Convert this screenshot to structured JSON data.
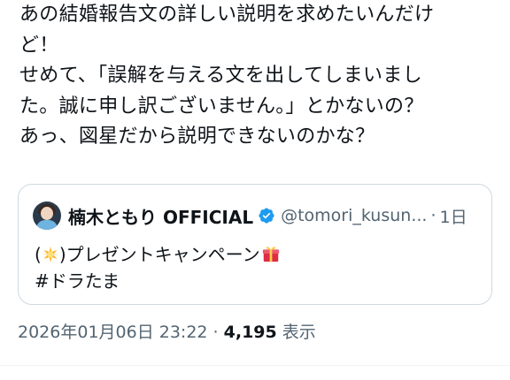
{
  "tweet": {
    "lines": [
      "あの結婚報告文の詳しい説明を求めたいんだけ",
      "ど！",
      "せめて、「誤解を与える文を出してしまいまし",
      "た。誠に申し訳ございません。」とかないの？",
      "あっ、図星だから説明できないのかな？"
    ]
  },
  "quote": {
    "display_name": "楠木ともり OFFICIAL",
    "handle": "@tomori_kusun...",
    "separator": "·",
    "age": "1日",
    "text_line1_open": "(",
    "text_line1_rest": ")プレゼントキャンペーン",
    "text_line2": "#ドラたま",
    "emoji_sun": "glowing-star-emoji",
    "emoji_gift": "gift-emoji",
    "verified_icon": "verified-badge-icon",
    "verified_color": "#1d9bf0"
  },
  "meta": {
    "timestamp": "2026年01月06日 23:22",
    "separator": " · ",
    "views_count": "4,195",
    "views_label": " 表示"
  }
}
